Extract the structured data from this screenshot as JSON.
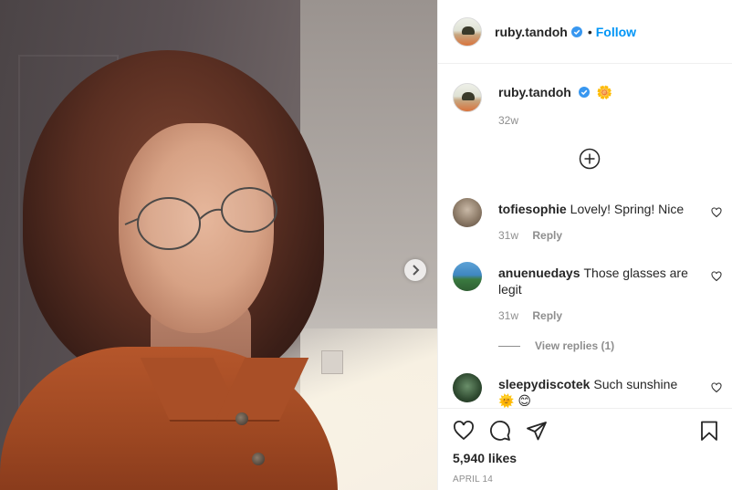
{
  "post": {
    "author": "ruby.tandoh",
    "follow_label": "Follow",
    "separator": "•",
    "caption_emoji": "🌼",
    "caption_time": "32w",
    "likes": "5,940 likes",
    "date": "APRIL 14",
    "reply_label": "Reply"
  },
  "comments": [
    {
      "user": "tofiesophie",
      "text": "Lovely! Spring! Nice",
      "time": "31w"
    },
    {
      "user": "anuenuedays",
      "text": "Those glasses are legit",
      "time": "31w",
      "view_replies": "View replies (1)"
    },
    {
      "user": "sleepydiscotek",
      "text": "Such sunshine 🌞 😊"
    }
  ],
  "colors": {
    "accent": "#0095f6",
    "verified": "#3897f0",
    "muted": "#8e8e8e",
    "text": "#262626"
  },
  "icons": [
    "verified-badge-icon",
    "plus-circle-icon",
    "heart-icon",
    "comment-icon",
    "share-icon",
    "bookmark-icon",
    "chevron-right-icon"
  ]
}
